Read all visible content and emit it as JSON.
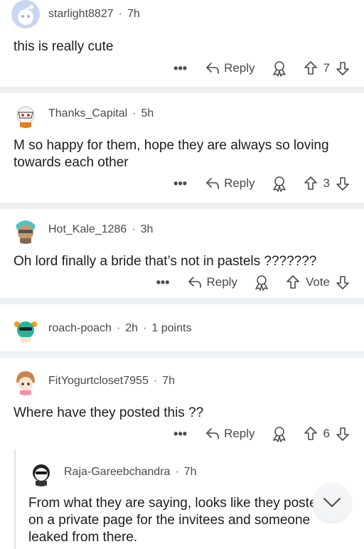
{
  "comments": [
    {
      "username": "starlight8827",
      "time": "7h",
      "body": "this is really cute",
      "more": "•••",
      "reply": "Reply",
      "votes": "7"
    },
    {
      "username": "Thanks_Capital",
      "time": "5h",
      "body": "M so happy for them, hope they are always so loving towards each other",
      "more": "•••",
      "reply": "Reply",
      "votes": "3"
    },
    {
      "username": "Hot_Kale_1286",
      "time": "3h",
      "body": "Oh lord finally a bride that’s not in pastels ???????",
      "more": "•••",
      "reply": "Reply",
      "votes": "Vote"
    },
    {
      "username": "roach-poach",
      "time": "2h",
      "points": "1 points"
    },
    {
      "username": "FitYogurtcloset7955",
      "time": "7h",
      "body": "Where have they posted this ??",
      "more": "•••",
      "reply": "Reply",
      "votes": "6"
    },
    {
      "username": "Raja-Gareebchandra",
      "time": "7h",
      "body": "From what they are saying, looks like they posted it on a private page for the invitees and someone leaked from there."
    }
  ],
  "dot": "·",
  "icons": {
    "reply": "reply-arrow-icon",
    "award": "award-icon",
    "upvote": "upvote-arrow-icon",
    "downvote": "downvote-arrow-icon",
    "scroll": "chevron-down-icon"
  },
  "colors": {
    "divider": "#eef0f1",
    "text": "#1c1c1c",
    "meta": "#4a4a4a"
  }
}
